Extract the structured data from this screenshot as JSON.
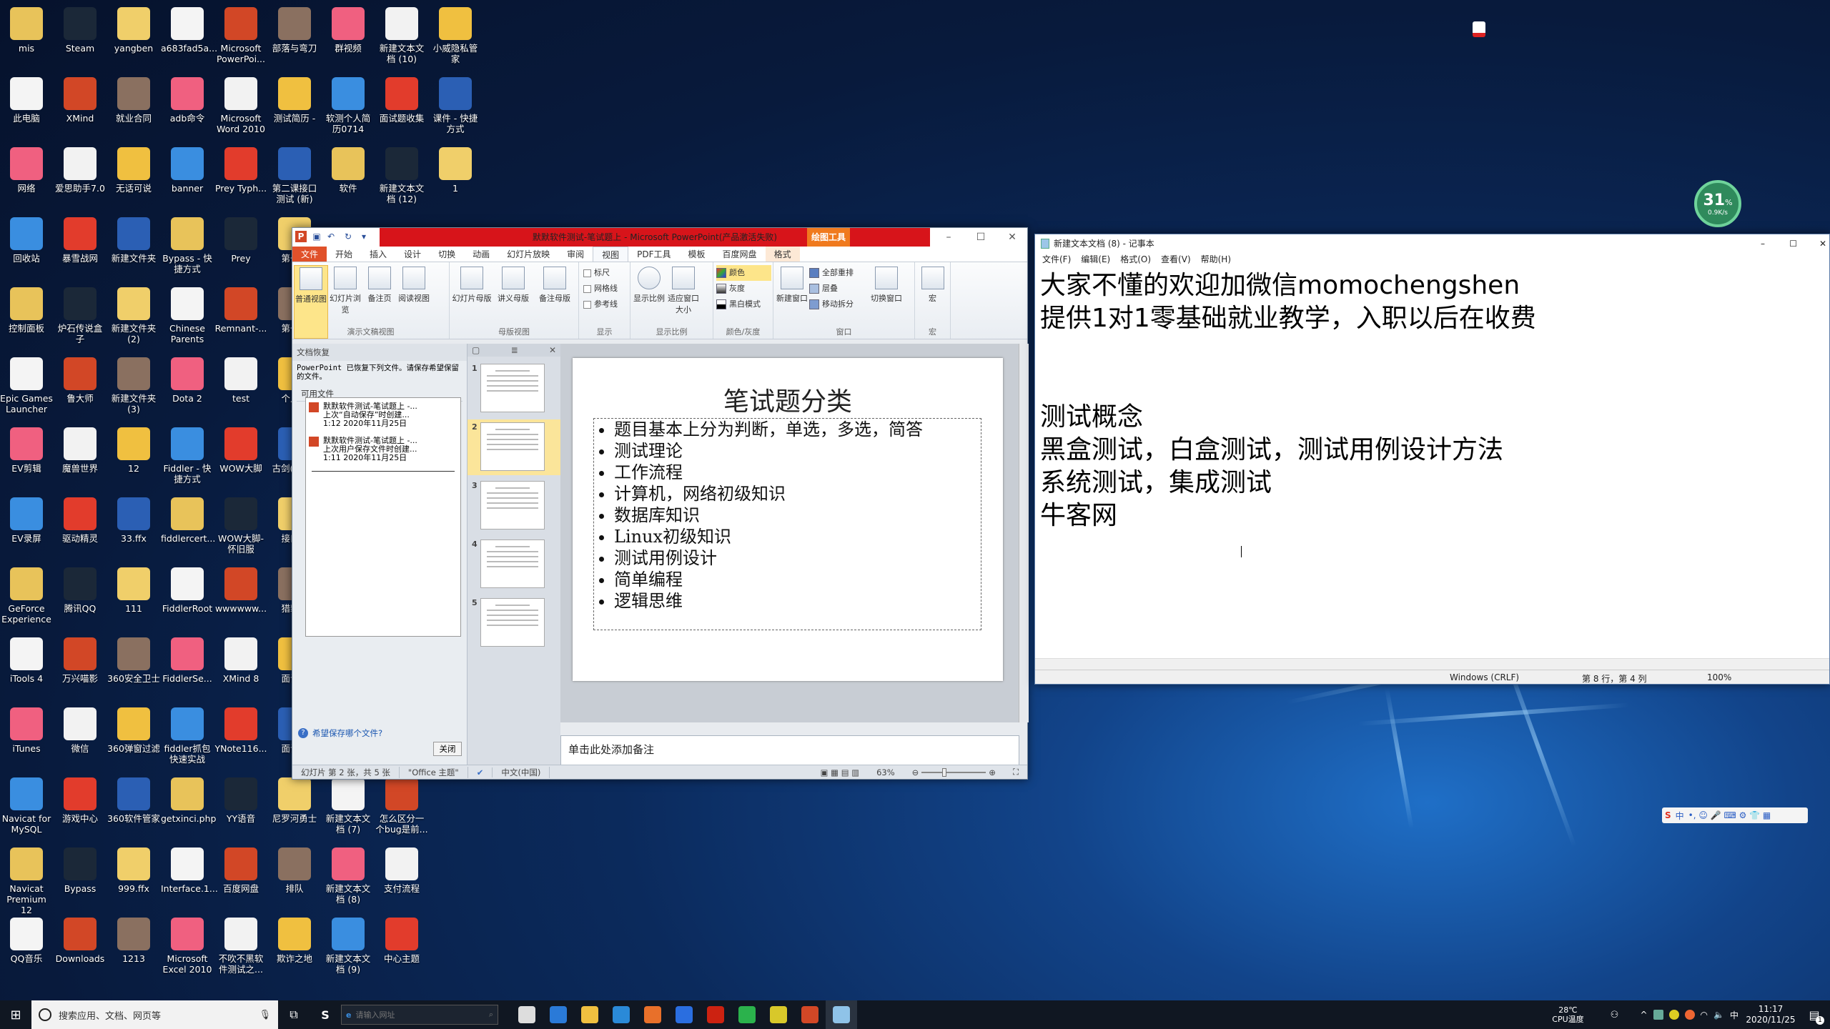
{
  "desktop": {
    "rows": [
      [
        "mis",
        "Steam",
        "yangben",
        "a683fad5a...",
        "Microsoft PowerPoi...",
        "部落与弯刀",
        "群视频",
        "新建文本文档 (10)",
        "小威隐私管家"
      ],
      [
        "此电脑",
        "XMind",
        "就业合同",
        "adb命令",
        "Microsoft Word 2010",
        "测试简历 -",
        "软测个人简历0714",
        "面试题收集",
        "课件 - 快捷方式"
      ],
      [
        "网络",
        "爱思助手7.0",
        "无话可说",
        "banner",
        "Prey Typh...",
        "第二课接口测试 (新)",
        "软件",
        "新建文本文档 (12)",
        "1"
      ],
      [
        "回收站",
        "暴雪战网",
        "新建文件夹",
        "Bypass - 快捷方式",
        "Prey",
        "第一..."
      ],
      [
        "控制面板",
        "炉石传说盒子",
        "新建文件夹 (2)",
        "Chinese Parents",
        "Remnant-...",
        "第一..."
      ],
      [
        "Epic Games Launcher",
        "鲁大师",
        "新建文件夹 (3)",
        "Dota 2",
        "test",
        "个人..."
      ],
      [
        "EV剪辑",
        "魔兽世界",
        "12",
        "Fiddler - 快捷方式",
        "WOW大脚",
        "古剑(Guj..."
      ],
      [
        "EV录屏",
        "驱动精灵",
        "33.ffx",
        "fiddlercert...",
        "WOW大脚-怀旧服",
        "接口..."
      ],
      [
        "GeForce Experience",
        "腾讯QQ",
        "111",
        "FiddlerRoot",
        "wwwwww...",
        "猎豹..."
      ],
      [
        "iTools 4",
        "万兴喵影",
        "360安全卫士",
        "FiddlerSe...",
        "XMind 8",
        "面试..."
      ],
      [
        "iTunes",
        "微信",
        "360弹窗过滤",
        "fiddler抓包快速实战",
        "YNote116...",
        "面试..."
      ],
      [
        "Navicat for MySQL",
        "游戏中心",
        "360软件管家",
        "getxinci.php",
        "YY语音",
        "尼罗河勇士",
        "新建文本文档 (7)",
        "怎么区分一个bug是前..."
      ],
      [
        "Navicat Premium 12",
        "Bypass",
        "999.ffx",
        "Interface.1...",
        "百度网盘",
        "排队",
        "新建文本文档 (8)",
        "支付流程"
      ],
      [
        "QQ音乐",
        "Downloads",
        "1213",
        "Microsoft Excel 2010",
        "不吹不黑软件测试之...",
        "欺诈之地",
        "新建文本文档 (9)",
        "中心主题"
      ]
    ],
    "icon_colors": [
      "#e8c35a",
      "#1b2838",
      "#f0cf6a",
      "#f4f4f4",
      "#d24726",
      "#8a7060",
      "#f06080",
      "#f2f2f2",
      "#f0c040",
      "#3a8ee0",
      "#e23c2c",
      "#2b5fb4"
    ]
  },
  "widget": {
    "percent": "31",
    "unit": "%",
    "sub": "0.9K/s"
  },
  "ppt": {
    "title": "默默软件测试-笔试题上 - Microsoft PowerPoint(产品激活失败)",
    "context_tab": "绘图工具",
    "tabs": [
      "文件",
      "开始",
      "插入",
      "设计",
      "切换",
      "动画",
      "幻灯片放映",
      "审阅",
      "视图",
      "PDF工具",
      "模板",
      "百度网盘",
      "格式"
    ],
    "ribbon": {
      "groups": [
        {
          "label": "演示文稿视图",
          "buttons": [
            "普通视图",
            "幻灯片浏览",
            "备注页",
            "阅读视图"
          ]
        },
        {
          "label": "母版视图",
          "buttons": [
            "幻灯片母版",
            "讲义母版",
            "备注母版"
          ]
        },
        {
          "label": "显示",
          "checks": [
            "标尺",
            "网格线",
            "参考线"
          ]
        },
        {
          "label": "显示比例",
          "buttons": [
            "显示比例",
            "适应窗口大小"
          ]
        },
        {
          "label": "颜色/灰度",
          "small": [
            "颜色",
            "灰度",
            "黑白模式"
          ]
        },
        {
          "label": "窗口",
          "buttons": [
            "新建窗口"
          ],
          "small": [
            "全部重排",
            "层叠",
            "移动拆分"
          ],
          "buttons2": [
            "切换窗口"
          ]
        },
        {
          "label": "宏",
          "buttons": [
            "宏"
          ]
        }
      ]
    },
    "recovery": {
      "title": "文档恢复",
      "message": "PowerPoint 已恢复下列文件。请保存希望保留的文件。",
      "available": "可用文件",
      "files": [
        {
          "name": "默默软件测试-笔试题上 -...",
          "desc": "上次“自动保存”时创建...",
          "time": "1:12  2020年11月25日"
        },
        {
          "name": "默默软件测试-笔试题上 -...",
          "desc": "上次用户保存文件时创建...",
          "time": "1:11  2020年11月25日"
        }
      ],
      "help_link": "希望保存哪个文件?",
      "close": "关闭"
    },
    "slides": [
      "1",
      "2",
      "3",
      "4",
      "5"
    ],
    "current_slide": 2,
    "slide": {
      "title": "笔试题分类",
      "bullets": [
        "题目基本上分为判断，单选，多选，简答",
        "测试理论",
        "工作流程",
        "计算机，网络初级知识",
        "数据库知识",
        "Linux初级知识",
        "测试用例设计",
        "简单编程",
        "逻辑思维"
      ]
    },
    "notes_placeholder": "单击此处添加备注",
    "status": {
      "slide": "幻灯片 第 2 张，共 5 张",
      "theme": "\"Office 主题\"",
      "lang": "中文(中国)",
      "zoom": "63%",
      "zoom_level": 63
    }
  },
  "notepad": {
    "title": "新建文本文档 (8) - 记事本",
    "menu": [
      "文件(F)",
      "编辑(E)",
      "格式(O)",
      "查看(V)",
      "帮助(H)"
    ],
    "lines": [
      "大家不懂的欢迎加微信momochengshen",
      "提供1对1零基础就业教学，入职以后在收费",
      "",
      "",
      "测试概念",
      "黑盒测试，白盒测试，测试用例设计方法",
      "系统测试，集成测试",
      "牛客网"
    ],
    "status": {
      "eol": "Windows (CRLF)",
      "pos": "第 8 行，第 4 列",
      "zoom": "100%"
    }
  },
  "taskbar": {
    "search_placeholder": "搜索应用、文档、网页等",
    "browser_placeholder": "请输入网址",
    "pinned": [
      "store",
      "edge",
      "explorer",
      "mail",
      "firefox",
      "feishu",
      "screen-recorder",
      "wechat",
      "360",
      "powerpoint",
      "notepad"
    ],
    "cpu_temp": "28℃",
    "cpu_label": "CPU温度",
    "ime": "中",
    "time": "11:17",
    "date": "2020/11/25",
    "notifications": "1"
  }
}
